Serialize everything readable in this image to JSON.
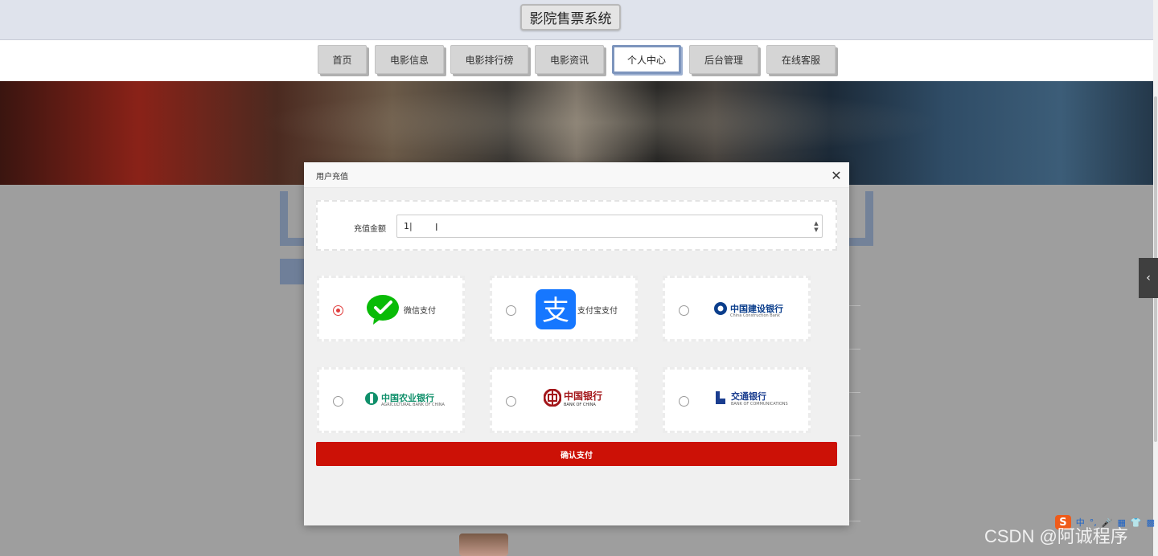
{
  "site": {
    "title": "影院售票系统"
  },
  "nav": {
    "items": [
      {
        "label": "首页"
      },
      {
        "label": "电影信息"
      },
      {
        "label": "电影排行榜"
      },
      {
        "label": "电影资讯"
      },
      {
        "label": "个人中心"
      },
      {
        "label": "后台管理"
      },
      {
        "label": "在线客服"
      }
    ],
    "active_label": "个人中心"
  },
  "modal": {
    "title": "用户充值",
    "close_icon": "close-icon",
    "amount_label": "充值金额",
    "amount_value": "1",
    "payment_methods": [
      {
        "label": "微信支付",
        "icon": "wechat-pay-icon",
        "selected": true
      },
      {
        "label": "支付宝支付",
        "icon": "alipay-icon",
        "selected": false
      },
      {
        "label": "中国建设银行",
        "sublabel": "China Construction Bank",
        "icon": "ccb-logo",
        "selected": false
      },
      {
        "label": "中国农业银行",
        "sublabel": "AGRICULTURAL BANK OF CHINA",
        "icon": "abc-logo",
        "selected": false
      },
      {
        "label": "中国银行",
        "sublabel": "BANK OF CHINA",
        "icon": "boc-logo",
        "selected": false
      },
      {
        "label": "交通银行",
        "sublabel": "BANK OF COMMUNICATIONS",
        "icon": "bocom-logo",
        "selected": false
      }
    ],
    "confirm_label": "确认支付"
  },
  "ime": {
    "items": [
      "S",
      "中",
      "°,",
      "🎤",
      "▦",
      "👕",
      "▩"
    ]
  },
  "watermark": "CSDN @阿诚程序",
  "colors": {
    "accent": "#cc1106",
    "nav_active": "#7d95bd",
    "wechat": "#09bb07",
    "alipay": "#1677ff"
  }
}
